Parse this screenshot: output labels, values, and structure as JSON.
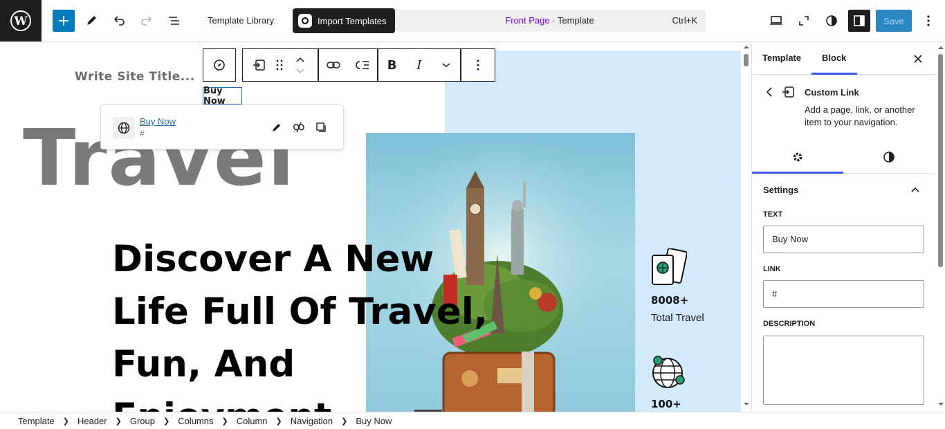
{
  "topbar": {
    "template_library": "Template Library",
    "import_templates": "Import Templates",
    "command": {
      "page": "Front Page",
      "separator": " · ",
      "type": "Template",
      "shortcut": "Ctrl+K"
    },
    "save": "Save"
  },
  "canvas": {
    "site_title": "Write Site Title...",
    "nav_item": "Buy Now",
    "travel": "Travel",
    "heading_lines": [
      "Discover A New",
      "Life Full Of Travel,",
      "Fun, And",
      "Enjoyment"
    ],
    "stats": [
      {
        "number": "8008+",
        "label": "Total Travel"
      },
      {
        "number": "100+",
        "label": ""
      }
    ]
  },
  "link_popover": {
    "text": "Buy Now",
    "url": "#"
  },
  "sidebar": {
    "tabs": [
      "Template",
      "Block"
    ],
    "active_tab": "Block",
    "block": {
      "name": "Custom Link",
      "description": "Add a page, link, or another item to your navigation."
    },
    "settings_title": "Settings",
    "fields": {
      "text_label": "TEXT",
      "text_value": "Buy Now",
      "link_label": "LINK",
      "link_value": "#",
      "description_label": "DESCRIPTION",
      "description_value": ""
    }
  },
  "breadcrumb": [
    "Template",
    "Header",
    "Group",
    "Columns",
    "Column",
    "Navigation",
    "Buy Now"
  ],
  "colors": {
    "accent": "#007cba",
    "command_page": "#7a00df",
    "canvas_blue": "#d2eafc",
    "sidebar_tab_active": "#3858e9"
  }
}
